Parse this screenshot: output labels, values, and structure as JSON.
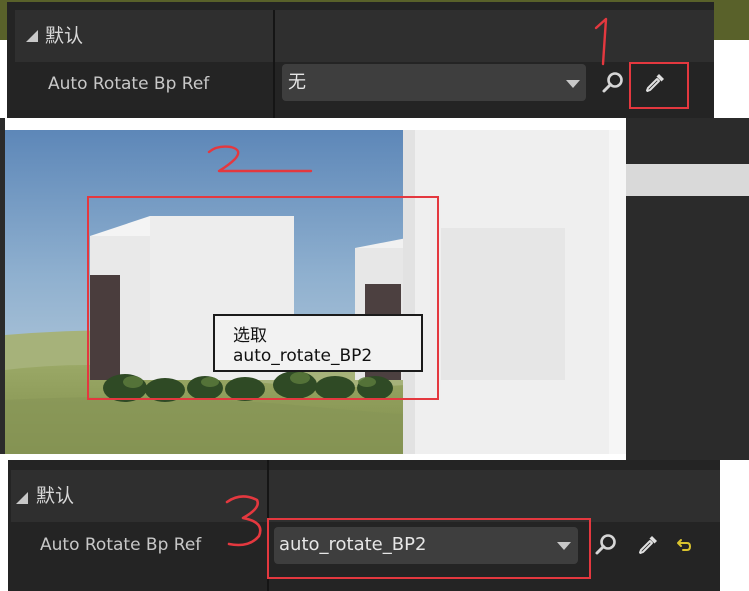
{
  "top_panel": {
    "category": "默认",
    "property_label": "Auto Rotate Bp Ref",
    "combo_value": "无",
    "buttons": {
      "browse_icon": "search-icon",
      "picker_icon": "eyedropper-icon"
    }
  },
  "viewport": {
    "tooltip": "选取auto_rotate_BP2"
  },
  "bottom_panel": {
    "category": "默认",
    "property_label": "Auto Rotate Bp Ref",
    "combo_value": "auto_rotate_BP2",
    "buttons": {
      "browse_icon": "search-icon",
      "picker_icon": "eyedropper-icon",
      "reset_icon": "reset-arrow-icon"
    }
  },
  "annotations": [
    "1",
    "2",
    "3"
  ],
  "colors": {
    "annotation_red": "#e4383f",
    "panel_bg": "#242424",
    "header_bg": "#2f2f2f",
    "combo_bg": "#3e3e3e",
    "reset_yellow": "#d9c32e"
  }
}
